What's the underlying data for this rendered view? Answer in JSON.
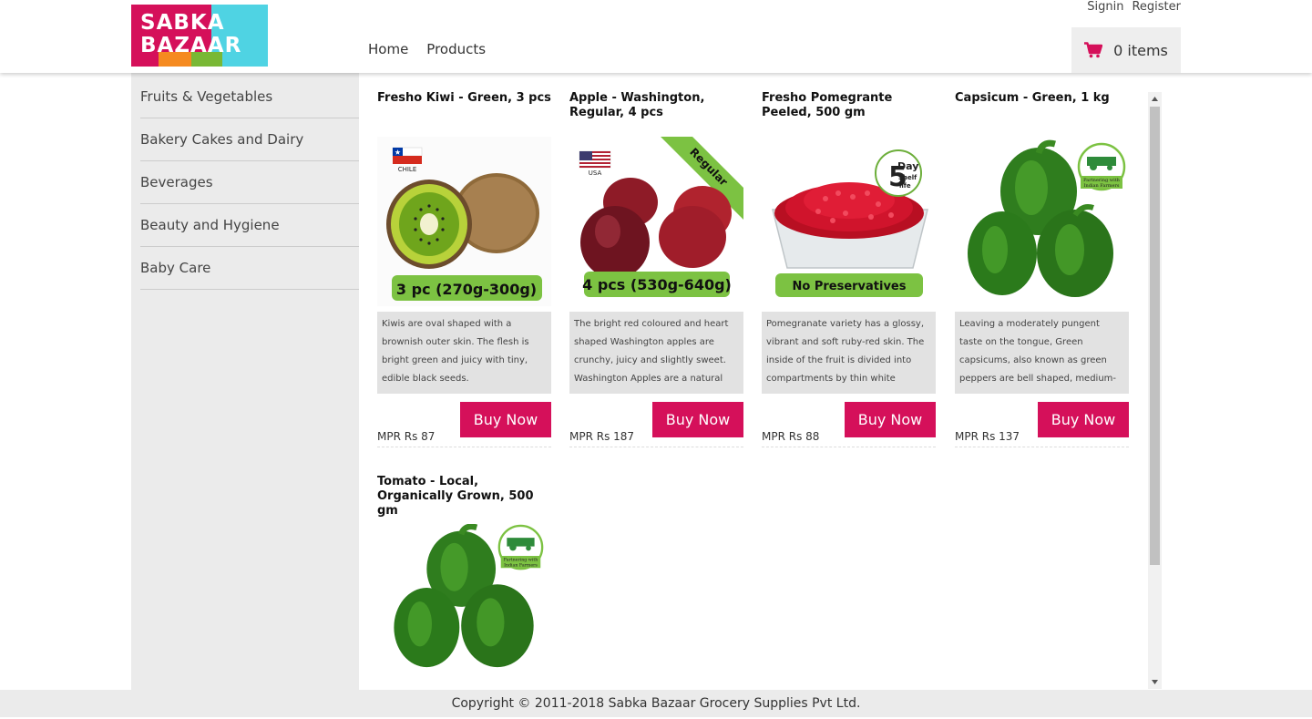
{
  "header": {
    "logo_text_line1": "SABKA",
    "logo_text_line2": "BAZAAR",
    "nav": [
      {
        "label": "Home"
      },
      {
        "label": "Products"
      }
    ],
    "signin_label": "Signin",
    "register_label": "Register",
    "cart": {
      "icon": "cart-icon",
      "count_label": "0 items"
    }
  },
  "sidebar": {
    "categories": [
      {
        "label": "Fruits & Vegetables"
      },
      {
        "label": "Bakery Cakes and Dairy"
      },
      {
        "label": "Beverages"
      },
      {
        "label": "Beauty and Hygiene"
      },
      {
        "label": "Baby Care"
      }
    ]
  },
  "products": [
    {
      "title": "Fresho Kiwi - Green, 3 pcs",
      "image_badge": "3 pc (270g-300g)",
      "flag_label": "CHILE",
      "description": "Kiwis are oval shaped with a brownish outer skin. The flesh is bright green and juicy with tiny, edible black seeds.",
      "price": "MPR Rs 87",
      "buy_label": "Buy Now"
    },
    {
      "title": "Apple - Washington, Regular, 4 pcs",
      "image_badge": "4 pcs (530g-640g)",
      "flag_label": "USA",
      "ribbon": "Regular",
      "description": "The bright red coloured and heart shaped Washington apples are crunchy, juicy and slightly sweet. Washington Apples are a natural",
      "price": "MPR Rs 187",
      "buy_label": "Buy Now"
    },
    {
      "title": "Fresho Pomegrante Peeled, 500 gm",
      "image_badge": "No Preservatives",
      "shelf_life_num": "5",
      "shelf_life_text1": "Day",
      "shelf_life_text2": "Shelf",
      "shelf_life_text3": "life",
      "description": "Pomegranate variety has a glossy, vibrant and soft ruby-red skin. The inside of the fruit is divided into compartments by thin white",
      "price": "MPR Rs 88",
      "buy_label": "Buy Now"
    },
    {
      "title": "Capsicum - Green, 1 kg",
      "farmer_badge_1": "Partnering with",
      "farmer_badge_2": "Indian Farmers",
      "description": "Leaving a moderately pungent taste on the tongue, Green capsicums, also known as green peppers are bell shaped, medium-",
      "price": "MPR Rs 137",
      "buy_label": "Buy Now"
    },
    {
      "title": "Tomato - Local, Organically Grown, 500 gm",
      "farmer_badge_1": "Partnering with",
      "farmer_badge_2": "Indian Farmers"
    }
  ],
  "footer": {
    "copyright": "Copyright © 2011-2018 Sabka Bazaar Grocery Supplies Pvt Ltd."
  },
  "colors": {
    "brand_pink": "#d5105a",
    "brand_cyan": "#4fd3e3",
    "sidebar_bg": "#ebebeb",
    "badge_green": "#7cc242"
  }
}
